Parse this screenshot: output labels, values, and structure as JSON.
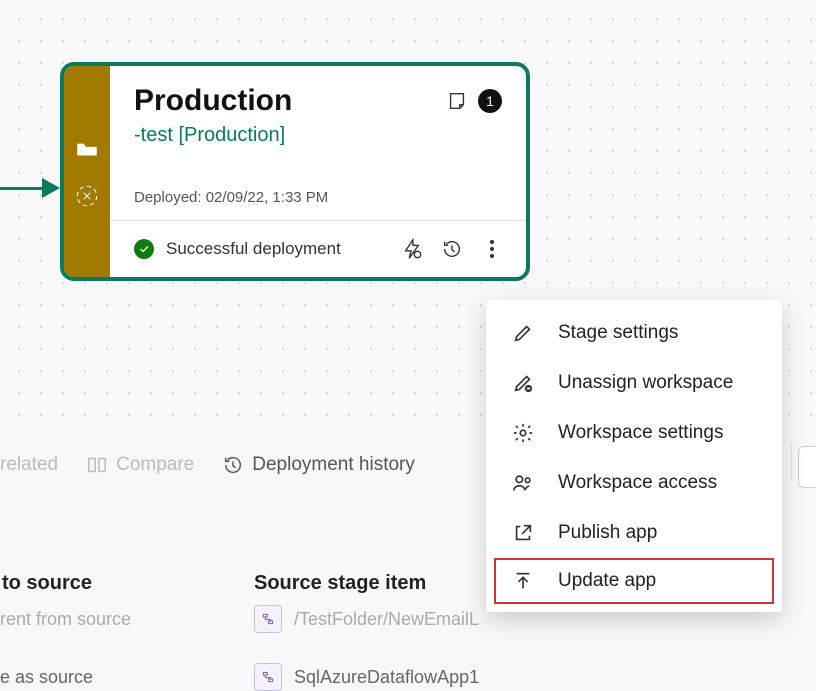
{
  "stage": {
    "title": "Production",
    "subtitle": "-test [Production]",
    "deployed_label": "Deployed: 02/09/22, 1:33 PM",
    "status_text": "Successful deployment",
    "badge_count": "1"
  },
  "menu": {
    "items": [
      {
        "label": "Stage settings"
      },
      {
        "label": "Unassign workspace"
      },
      {
        "label": "Workspace settings"
      },
      {
        "label": "Workspace access"
      },
      {
        "label": "Publish app"
      },
      {
        "label": "Update app"
      }
    ]
  },
  "toolbar": {
    "related": "related",
    "compare": "Compare",
    "history": "Deployment history"
  },
  "columns": {
    "to_source": "to source",
    "source_stage_item": "Source stage item",
    "row1_a": "rent from source",
    "row1_b": "/TestFolder/NewEmailL",
    "row2_a": "e as source",
    "row2_b": "SqlAzureDataflowApp1"
  }
}
